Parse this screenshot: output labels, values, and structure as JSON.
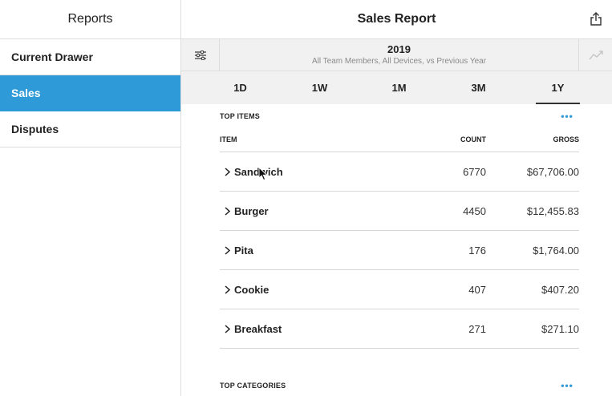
{
  "sidebar": {
    "title": "Reports",
    "items": [
      {
        "label": "Current Drawer",
        "active": false
      },
      {
        "label": "Sales",
        "active": true
      },
      {
        "label": "Disputes",
        "active": false
      }
    ]
  },
  "header": {
    "title": "Sales Report",
    "export_icon": "share-export-icon"
  },
  "filter": {
    "icon": "sliders-icon",
    "year": "2019",
    "subtitle": "All Team Members, All Devices, vs Previous Year",
    "trend_icon": "trend-line-icon"
  },
  "range_tabs": [
    {
      "label": "1D",
      "active": false
    },
    {
      "label": "1W",
      "active": false
    },
    {
      "label": "1M",
      "active": false
    },
    {
      "label": "3M",
      "active": false
    },
    {
      "label": "1Y",
      "active": true
    }
  ],
  "top_items": {
    "title": "TOP ITEMS",
    "more": "•••",
    "columns": {
      "item": "ITEM",
      "count": "COUNT",
      "gross": "GROSS"
    },
    "rows": [
      {
        "name": "Sandwich",
        "count": "6770",
        "gross": "$67,706.00"
      },
      {
        "name": "Burger",
        "count": "4450",
        "gross": "$12,455.83"
      },
      {
        "name": "Pita",
        "count": "176",
        "gross": "$1,764.00"
      },
      {
        "name": "Cookie",
        "count": "407",
        "gross": "$407.20"
      },
      {
        "name": "Breakfast",
        "count": "271",
        "gross": "$271.10"
      }
    ]
  },
  "top_categories": {
    "title": "TOP CATEGORIES",
    "more": "•••"
  },
  "colors": {
    "accent": "#2f9ad8",
    "band": "#f1f1f2",
    "divider": "#dcdcdc"
  }
}
